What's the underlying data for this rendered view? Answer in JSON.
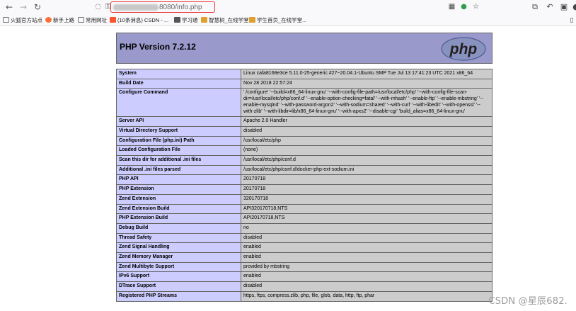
{
  "browser": {
    "url_suffix": "8080/info.php",
    "bookmarks": [
      {
        "label": "火狐官方站点",
        "icon": "folder-icon",
        "color": "#777777"
      },
      {
        "label": "新手上路",
        "icon": "firefox-icon",
        "color": "#ff7139"
      },
      {
        "label": "常用网址",
        "icon": "folder-icon",
        "color": "#777777"
      },
      {
        "label": "(10条消息) CSDN - ...",
        "icon": "csdn-icon",
        "color": "#fc5531"
      },
      {
        "label": "学习通",
        "icon": "xuexitong-icon",
        "color": "#555555"
      },
      {
        "label": "智慧树_在线学堂",
        "icon": "zhihuishu-icon",
        "color": "#e0a030"
      },
      {
        "label": "学生首页_在线学堂...",
        "icon": "zhihuishu-icon",
        "color": "#e0a030"
      }
    ]
  },
  "phpinfo": {
    "title": "PHP Version 7.2.12",
    "logo_text": "php",
    "rows": [
      {
        "key": "System",
        "value": "Linux cafa8168e3ce 5.11.0-25-generic #27~20.04.1-Ubuntu SMP Tue Jul 13 17:41:23 UTC 2021 x86_64"
      },
      {
        "key": "Build Date",
        "value": "Nov 28 2018 22:57:24"
      },
      {
        "key": "Configure Command",
        "value": "'./configure' '--build=x86_64-linux-gnu' '--with-config-file-path=/usr/local/etc/php' '--with-config-file-scan-dir=/usr/local/etc/php/conf.d' '--enable-option-checking=fatal' '--with-mhash' '--enable-ftp' '--enable-mbstring' '--enable-mysqlnd' '--with-password-argon2' '--with-sodium=shared' '--with-curl' '--with-libedit' '--with-openssl' '--with-zlib' '--with-libdir=lib/x86_64-linux-gnu' '--with-apxs2' '--disable-cgi' 'build_alias=x86_64-linux-gnu'"
      },
      {
        "key": "Server API",
        "value": "Apache 2.0 Handler"
      },
      {
        "key": "Virtual Directory Support",
        "value": "disabled"
      },
      {
        "key": "Configuration File (php.ini) Path",
        "value": "/usr/local/etc/php"
      },
      {
        "key": "Loaded Configuration File",
        "value": "(none)"
      },
      {
        "key": "Scan this dir for additional .ini files",
        "value": "/usr/local/etc/php/conf.d"
      },
      {
        "key": "Additional .ini files parsed",
        "value": "/usr/local/etc/php/conf.d/docker-php-ext-sodium.ini"
      },
      {
        "key": "PHP API",
        "value": "20170718"
      },
      {
        "key": "PHP Extension",
        "value": "20170718"
      },
      {
        "key": "Zend Extension",
        "value": "320170718"
      },
      {
        "key": "Zend Extension Build",
        "value": "API320170718,NTS"
      },
      {
        "key": "PHP Extension Build",
        "value": "API20170718,NTS"
      },
      {
        "key": "Debug Build",
        "value": "no"
      },
      {
        "key": "Thread Safety",
        "value": "disabled"
      },
      {
        "key": "Zend Signal Handling",
        "value": "enabled"
      },
      {
        "key": "Zend Memory Manager",
        "value": "enabled"
      },
      {
        "key": "Zend Multibyte Support",
        "value": "provided by mbstring"
      },
      {
        "key": "IPv6 Support",
        "value": "enabled"
      },
      {
        "key": "DTrace Support",
        "value": "disabled"
      },
      {
        "key": "Registered PHP Streams",
        "value": "https, ftps, compress.zlib, php, file, glob, data, http, ftp, phar"
      }
    ]
  },
  "watermark": "CSDN @星辰682."
}
